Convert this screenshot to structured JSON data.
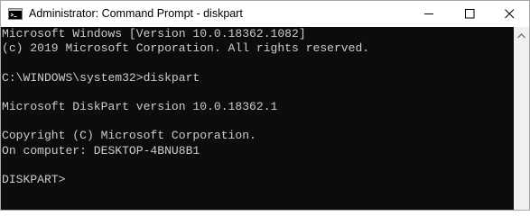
{
  "window": {
    "title": "Administrator: Command Prompt - diskpart"
  },
  "icons": {
    "app": "console-icon",
    "minimize": "minimize-icon",
    "maximize": "maximize-icon",
    "close": "close-icon",
    "scroll_up": "chevron-up-icon"
  },
  "colors": {
    "console_background": "#0c0c0c",
    "console_text": "#cccccc",
    "titlebar": "#ffffff"
  },
  "console": {
    "lines": [
      "Microsoft Windows [Version 10.0.18362.1082]",
      "(c) 2019 Microsoft Corporation. All rights reserved.",
      "",
      "C:\\WINDOWS\\system32>diskpart",
      "",
      "Microsoft DiskPart version 10.0.18362.1",
      "",
      "Copyright (C) Microsoft Corporation.",
      "On computer: DESKTOP-4BNU8B1",
      "",
      "DISKPART>"
    ]
  }
}
